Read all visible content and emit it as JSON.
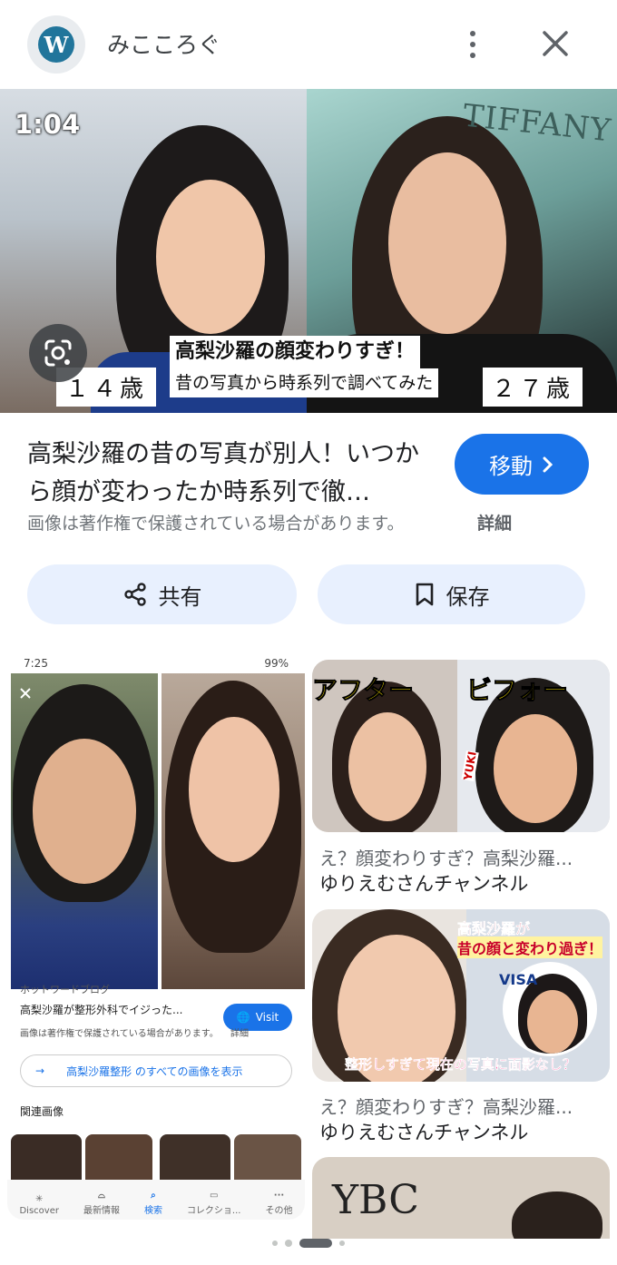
{
  "header": {
    "site_name": "みこころぐ",
    "logo_icon": "wordpress-icon",
    "more_icon": "more-vert-icon",
    "close_icon": "close-icon"
  },
  "hero": {
    "timecode": "1:04",
    "brand_watermark": "TIFFANY",
    "age_left": "１４歳",
    "age_right": "２７歳",
    "caption_line1": "高梨沙羅の顔変わりすぎ！",
    "caption_line2": "昔の写真から時系列で調べてみた",
    "lens_icon": "google-lens-icon"
  },
  "result": {
    "title": "高梨沙羅の昔の写真が別人！いつから顔が変わったか時系列で徹…",
    "visit_label": "移動",
    "copyright": "画像は著作権で保護されている場合があります。",
    "details_label": "詳細"
  },
  "actions": {
    "share_label": "共有",
    "save_label": "保存"
  },
  "related": {
    "screenshot": {
      "status_time": "7:25",
      "status_battery": "99%",
      "site": "ホットワードブログ",
      "title": "高梨沙羅が整形外科でイジった...",
      "visit": "Visit",
      "copyright": "画像は著作権で保護されている場合があります。",
      "details": "詳細",
      "search_text": "高梨沙羅整形 のすべての画像を表示",
      "related_heading": "関連画像",
      "nav": [
        "Discover",
        "最新情報",
        "検索",
        "コレクショ...",
        "その他"
      ]
    },
    "card1": {
      "label_after": "アフター",
      "label_before": "ビフォー",
      "logo_text": "YUKI",
      "title": "え？顔変わりすぎ？高梨沙羅...",
      "source": "ゆりえむさんチャンネル"
    },
    "card2": {
      "overlay_top": "高梨沙羅が",
      "overlay_mid": "昔の顔と変わり過ぎ！",
      "overlay_bottom": "整形しすぎて現在の写真に面影なし？",
      "logo_text": "VISA",
      "title": "え？顔変わりすぎ？高梨沙羅...",
      "source": "ゆりえむさんチャンネル"
    },
    "card3": {
      "logo_text": "YBC"
    }
  },
  "pager": {
    "active_index": 2,
    "count": 4
  }
}
